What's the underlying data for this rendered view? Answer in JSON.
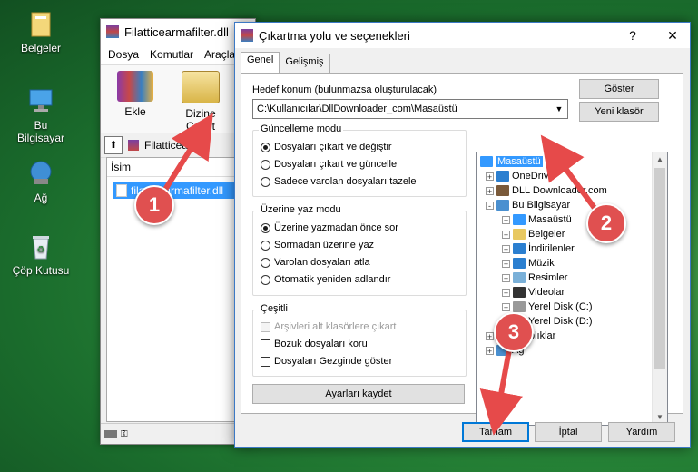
{
  "desktop": {
    "icons": [
      {
        "label": "Belgeler",
        "icon": "documents-folder-icon"
      },
      {
        "label": "Bu Bilgisayar",
        "icon": "computer-icon"
      },
      {
        "label": "Ağ",
        "icon": "network-icon"
      },
      {
        "label": "Çöp Kutusu",
        "icon": "recycle-bin-icon"
      }
    ]
  },
  "winrar": {
    "title": "Filatticearmafilter.dll",
    "menu": [
      "Dosya",
      "Komutlar",
      "Araçla"
    ],
    "toolbar": {
      "add_label": "Ekle",
      "extract_label": "Dizine Çıkart"
    },
    "address": "Filatticearm",
    "column_name": "İsim",
    "file": "filatticearmafilter.dll"
  },
  "dialog": {
    "title": "Çıkartma yolu ve seçenekleri",
    "help_label": "?",
    "close_label": "✕",
    "tabs": [
      "Genel",
      "Gelişmiş"
    ],
    "dest_label": "Hedef konum (bulunmazsa oluşturulacak)",
    "dest_value": "C:\\Kullanıcılar\\DllDownloader_com\\Masaüstü",
    "show_button": "Göster",
    "new_folder_button": "Yeni klasör",
    "update_mode": {
      "title": "Güncelleme modu",
      "options": [
        "Dosyaları çıkart ve değiştir",
        "Dosyaları çıkart ve güncelle",
        "Sadece varolan dosyaları tazele"
      ],
      "selected": 0
    },
    "overwrite_mode": {
      "title": "Üzerine yaz modu",
      "options": [
        "Üzerine yazmadan önce sor",
        "Sormadan üzerine yaz",
        "Varolan dosyaları atla",
        "Otomatik yeniden adlandır"
      ],
      "selected": 0
    },
    "misc": {
      "title": "Çeşitli",
      "options": [
        {
          "label": "Arşivleri alt klasörlere çıkart",
          "disabled": true
        },
        {
          "label": "Bozuk dosyaları koru",
          "disabled": false
        },
        {
          "label": "Dosyaları Gezginde göster",
          "disabled": false
        }
      ]
    },
    "save_settings_button": "Ayarları kaydet",
    "tree": [
      "Masaüstü",
      "OneDrive",
      "DLL Downloader.com",
      "Bu Bilgisayar",
      "Masaüstü",
      "Belgeler",
      "İndirilenler",
      "Müzik",
      "Resimler",
      "Videolar",
      "Yerel Disk (C:)",
      "Yerel Disk (D:)",
      "Kitaplıklar",
      "Ağ"
    ],
    "ok_button": "Tamam",
    "cancel_button": "İptal",
    "help_button": "Yardım"
  },
  "badges": [
    "1",
    "2",
    "3"
  ],
  "colors": {
    "accent": "#0078d7",
    "selection": "#3399ff",
    "badge": "#e05050",
    "arrow": "#e64a4a"
  }
}
